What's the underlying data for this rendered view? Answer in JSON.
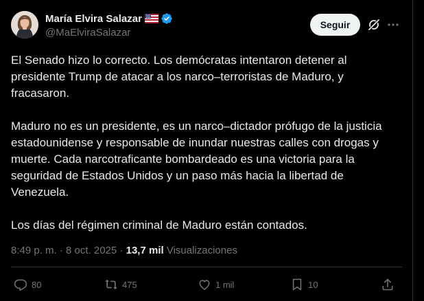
{
  "author": {
    "name": "María Elvira Salazar",
    "handle": "@MaElviraSalazar"
  },
  "follow_label": "Seguir",
  "icons": {
    "flag": "us-flag-icon",
    "verified": "verified-badge-icon",
    "grok": "grok-icon",
    "more": "more-icon",
    "reply": "reply-icon",
    "repost": "repost-icon",
    "like": "like-icon",
    "bookmark": "bookmark-icon",
    "share": "share-icon"
  },
  "colors": {
    "background": "#000000",
    "text": "#e7e9ea",
    "muted": "#71767b",
    "verified": "#1d9bf0",
    "follow_bg": "#eff3f4"
  },
  "tweet": {
    "paragraphs": [
      "El Senado hizo lo correcto. Los demócratas intentaron detener al presidente Trump de atacar a los narco–terroristas de Maduro, y fracasaron.",
      "Maduro no es un presidente, es un narco–dictador prófugo de la justicia estadounidense y responsable de inundar nuestras calles con drogas y muerte. Cada narcotraficante bombardeado es una victoria para la seguridad de Estados Unidos y un paso más hacia la libertad de Venezuela.",
      "Los días del régimen criminal de Maduro están contados."
    ],
    "time": "8:49 p. m.",
    "separator": "·",
    "date": "8 oct. 2025",
    "views_count": "13,7 mil",
    "views_label": "Visualizaciones"
  },
  "actions": {
    "replies": "80",
    "reposts": "475",
    "likes": "1 mil",
    "bookmarks": "10"
  }
}
